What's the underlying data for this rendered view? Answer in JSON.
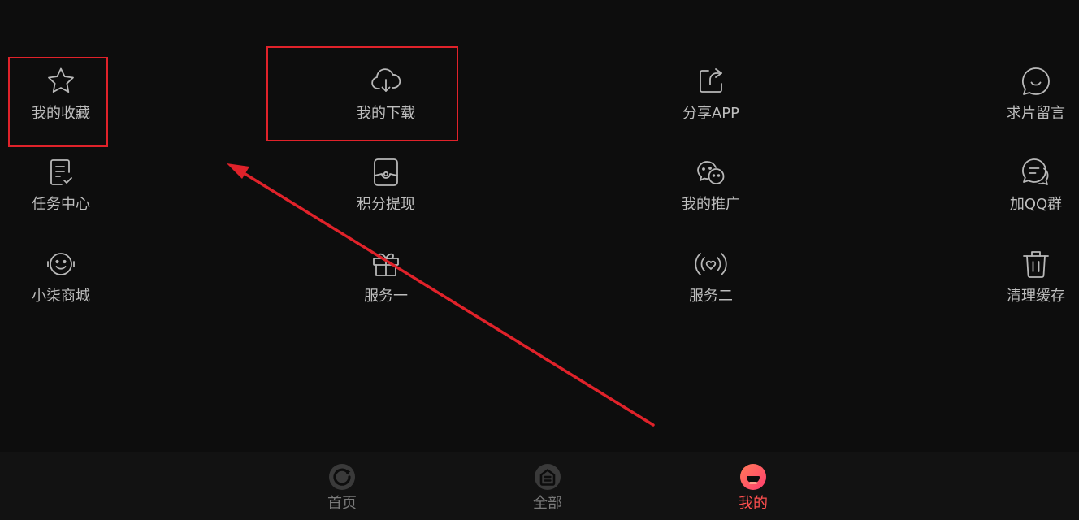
{
  "menu": {
    "items": [
      {
        "label": "我的收藏",
        "icon": "star-icon"
      },
      {
        "label": "我的下载",
        "icon": "cloud-download-icon"
      },
      {
        "label": "分享APP",
        "icon": "share-icon"
      },
      {
        "label": "求片留言",
        "icon": "chat-bubble-icon"
      },
      {
        "label": "任务中心",
        "icon": "task-list-icon"
      },
      {
        "label": "积分提现",
        "icon": "wallet-icon"
      },
      {
        "label": "我的推广",
        "icon": "wechat-icon"
      },
      {
        "label": "加QQ群",
        "icon": "group-chat-icon"
      },
      {
        "label": "小柒商城",
        "icon": "smile-headset-icon"
      },
      {
        "label": "服务一",
        "icon": "gift-icon"
      },
      {
        "label": "服务二",
        "icon": "broadcast-heart-icon"
      },
      {
        "label": "清理缓存",
        "icon": "trash-icon"
      }
    ]
  },
  "tabbar": {
    "tabs": [
      {
        "label": "首页",
        "icon": "home-icon",
        "active": false
      },
      {
        "label": "全部",
        "icon": "category-icon",
        "active": false
      },
      {
        "label": "我的",
        "icon": "profile-icon",
        "active": true
      }
    ]
  },
  "colors": {
    "background": "#0d0d0d",
    "text": "#bdbdbd",
    "active": "#ff4f4f",
    "annotation": "#e0222a"
  }
}
